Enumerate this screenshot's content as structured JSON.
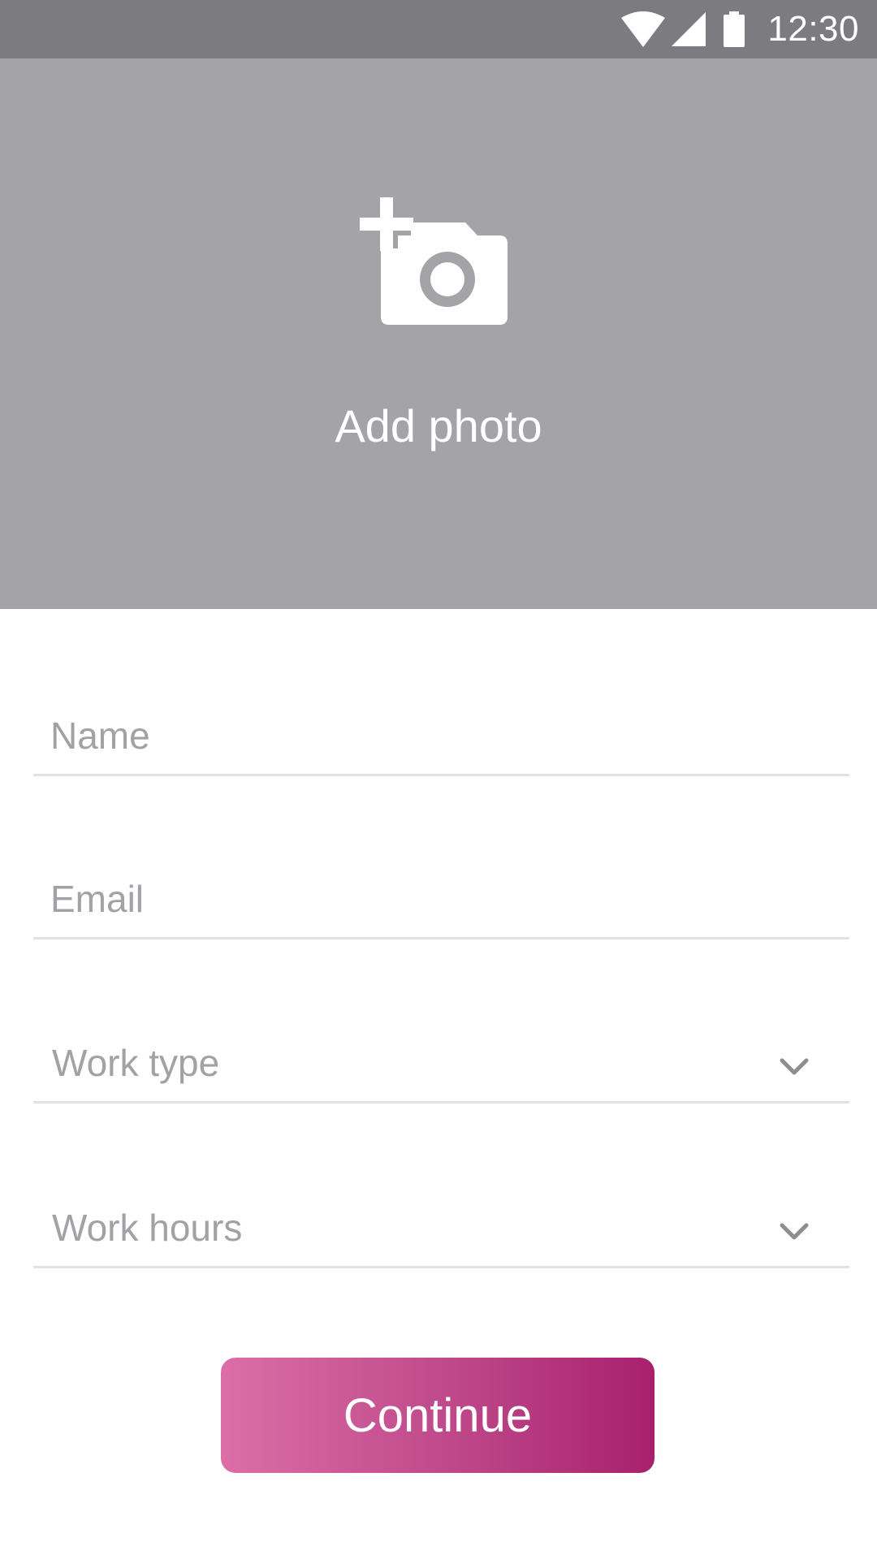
{
  "status_bar": {
    "time": "12:30",
    "icons": [
      "wifi-icon",
      "cell-signal-icon",
      "battery-icon"
    ]
  },
  "photo": {
    "label": "Add photo",
    "icon": "add-photo-icon",
    "background": "#a4a4a8"
  },
  "form": {
    "name": {
      "placeholder": "Name",
      "value": ""
    },
    "email": {
      "placeholder": "Email",
      "value": ""
    },
    "work_type": {
      "label": "Work type",
      "icon": "chevron-down-icon"
    },
    "work_hours": {
      "label": "Work hours",
      "icon": "chevron-down-icon"
    }
  },
  "actions": {
    "continue_label": "Continue",
    "gradient": [
      "#dc6ea6",
      "#a8206c"
    ]
  },
  "colors": {
    "status_bar": "#7c7b80",
    "placeholder": "#a2a2a6",
    "underline": "#e2e2e4"
  }
}
